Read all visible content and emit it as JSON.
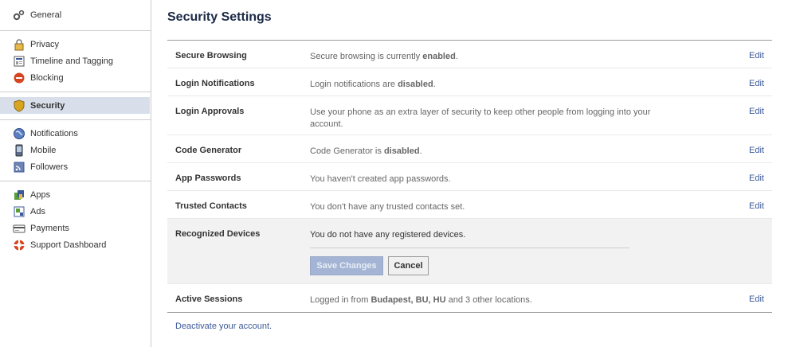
{
  "sidebar": {
    "groups": [
      {
        "items": [
          {
            "label": "General",
            "icon": "gears-icon"
          }
        ]
      },
      {
        "items": [
          {
            "label": "Privacy",
            "icon": "lock-icon"
          },
          {
            "label": "Timeline and Tagging",
            "icon": "timeline-icon"
          },
          {
            "label": "Blocking",
            "icon": "block-icon"
          }
        ]
      },
      {
        "items": [
          {
            "label": "Security",
            "icon": "shield-icon",
            "active": true
          }
        ]
      },
      {
        "items": [
          {
            "label": "Notifications",
            "icon": "globe-icon"
          },
          {
            "label": "Mobile",
            "icon": "phone-icon"
          },
          {
            "label": "Followers",
            "icon": "rss-icon"
          }
        ]
      },
      {
        "items": [
          {
            "label": "Apps",
            "icon": "apps-icon"
          },
          {
            "label": "Ads",
            "icon": "ads-icon"
          },
          {
            "label": "Payments",
            "icon": "card-icon"
          },
          {
            "label": "Support Dashboard",
            "icon": "lifebuoy-icon"
          }
        ]
      }
    ]
  },
  "main": {
    "title": "Security Settings",
    "edit_label": "Edit",
    "rows": [
      {
        "label": "Secure Browsing",
        "desc_pre": "Secure browsing is currently ",
        "desc_bold": "enabled",
        "desc_post": "."
      },
      {
        "label": "Login Notifications",
        "desc_pre": "Login notifications are ",
        "desc_bold": "disabled",
        "desc_post": "."
      },
      {
        "label": "Login Approvals",
        "desc_pre": "Use your phone as an extra layer of security to keep other people from logging into your account.",
        "desc_bold": "",
        "desc_post": ""
      },
      {
        "label": "Code Generator",
        "desc_pre": "Code Generator is ",
        "desc_bold": "disabled",
        "desc_post": "."
      },
      {
        "label": "App Passwords",
        "desc_pre": "You haven't created app passwords.",
        "desc_bold": "",
        "desc_post": ""
      },
      {
        "label": "Trusted Contacts",
        "desc_pre": "You don't have any trusted contacts set.",
        "desc_bold": "",
        "desc_post": ""
      }
    ],
    "recognized": {
      "label": "Recognized Devices",
      "desc": "You do not have any registered devices.",
      "save_label": "Save Changes",
      "cancel_label": "Cancel"
    },
    "active_sessions": {
      "label": "Active Sessions",
      "desc_pre": "Logged in from ",
      "desc_bold": "Budapest, BU, HU",
      "desc_post": " and 3 other locations."
    },
    "deactivate_link": "Deactivate your account."
  },
  "colors": {
    "link": "#3b5998",
    "title": "#1c2a47",
    "active_bg": "#d8dfea",
    "save_bg": "#a3b4d4"
  }
}
